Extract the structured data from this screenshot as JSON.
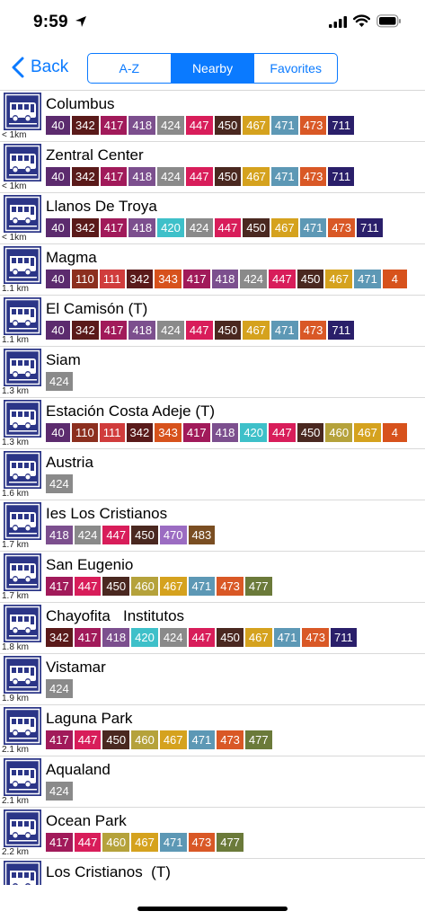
{
  "status_bar": {
    "time": "9:59",
    "icons": [
      "location-arrow-icon",
      "signal-icon",
      "wifi-icon",
      "battery-icon"
    ]
  },
  "nav": {
    "back_label": "Back",
    "segments": [
      {
        "label": "A-Z",
        "active": false
      },
      {
        "label": "Nearby",
        "active": true
      },
      {
        "label": "Favorites",
        "active": false
      }
    ]
  },
  "colors": {
    "accent": "#0a7aff",
    "stop_icon": "#2b3587",
    "routes": {
      "40": "#5c2b6e",
      "110": "#8c2f1f",
      "111": "#d03c3c",
      "342": "#5a1a1a",
      "343": "#d7521c",
      "417": "#a11a5a",
      "418": "#7c4f8e",
      "420": "#3ec0c9",
      "424": "#8a8a8a",
      "447": "#d81d5a",
      "450": "#4a2820",
      "460": "#b5a23b",
      "467": "#d5a21e",
      "470": "#9b6cc2",
      "471": "#5d98b5",
      "473": "#d95826",
      "477": "#6b7a3a",
      "483": "#7a4e22",
      "711": "#2a1f6a",
      "4": "#d7521c"
    }
  },
  "stops": [
    {
      "name": "Columbus",
      "distance": "< 1km",
      "routes": [
        "40",
        "342",
        "417",
        "418",
        "424",
        "447",
        "450",
        "467",
        "471",
        "473",
        "711"
      ]
    },
    {
      "name": "Zentral Center",
      "distance": "< 1km",
      "routes": [
        "40",
        "342",
        "417",
        "418",
        "424",
        "447",
        "450",
        "467",
        "471",
        "473",
        "711"
      ]
    },
    {
      "name": "Llanos De Troya",
      "distance": "< 1km",
      "routes": [
        "40",
        "342",
        "417",
        "418",
        "420",
        "424",
        "447",
        "450",
        "467",
        "471",
        "473",
        "711"
      ]
    },
    {
      "name": "Magma",
      "distance": "1.1 km",
      "routes": [
        "40",
        "110",
        "111",
        "342",
        "343",
        "417",
        "418",
        "424",
        "447",
        "450",
        "467",
        "471",
        "4"
      ]
    },
    {
      "name": "El Camisón (T)",
      "distance": "1.1 km",
      "routes": [
        "40",
        "342",
        "417",
        "418",
        "424",
        "447",
        "450",
        "467",
        "471",
        "473",
        "711"
      ]
    },
    {
      "name": "Siam",
      "distance": "1.3 km",
      "routes": [
        "424"
      ]
    },
    {
      "name": "Estación Costa Adeje (T)",
      "distance": "1.3 km",
      "routes": [
        "40",
        "110",
        "111",
        "342",
        "343",
        "417",
        "418",
        "420",
        "447",
        "450",
        "460",
        "467",
        "4"
      ]
    },
    {
      "name": "Austria",
      "distance": "1.6 km",
      "routes": [
        "424"
      ]
    },
    {
      "name": "Ies Los Cristianos",
      "distance": "1.7 km",
      "routes": [
        "418",
        "424",
        "447",
        "450",
        "470",
        "483"
      ]
    },
    {
      "name": "San Eugenio",
      "distance": "1.7 km",
      "routes": [
        "417",
        "447",
        "450",
        "460",
        "467",
        "471",
        "473",
        "477"
      ]
    },
    {
      "name": "Chayofita   Institutos",
      "distance": "1.8 km",
      "routes": [
        "342",
        "417",
        "418",
        "420",
        "424",
        "447",
        "450",
        "467",
        "471",
        "473",
        "711"
      ]
    },
    {
      "name": "Vistamar",
      "distance": "1.9 km",
      "routes": [
        "424"
      ]
    },
    {
      "name": "Laguna Park",
      "distance": "2.1 km",
      "routes": [
        "417",
        "447",
        "450",
        "460",
        "467",
        "471",
        "473",
        "477"
      ]
    },
    {
      "name": "Aqualand",
      "distance": "2.1 km",
      "routes": [
        "424"
      ]
    },
    {
      "name": "Ocean Park",
      "distance": "2.2 km",
      "routes": [
        "417",
        "447",
        "460",
        "467",
        "471",
        "473",
        "477"
      ]
    },
    {
      "name": "Los Cristianos  (T)",
      "distance": "",
      "routes": []
    }
  ]
}
